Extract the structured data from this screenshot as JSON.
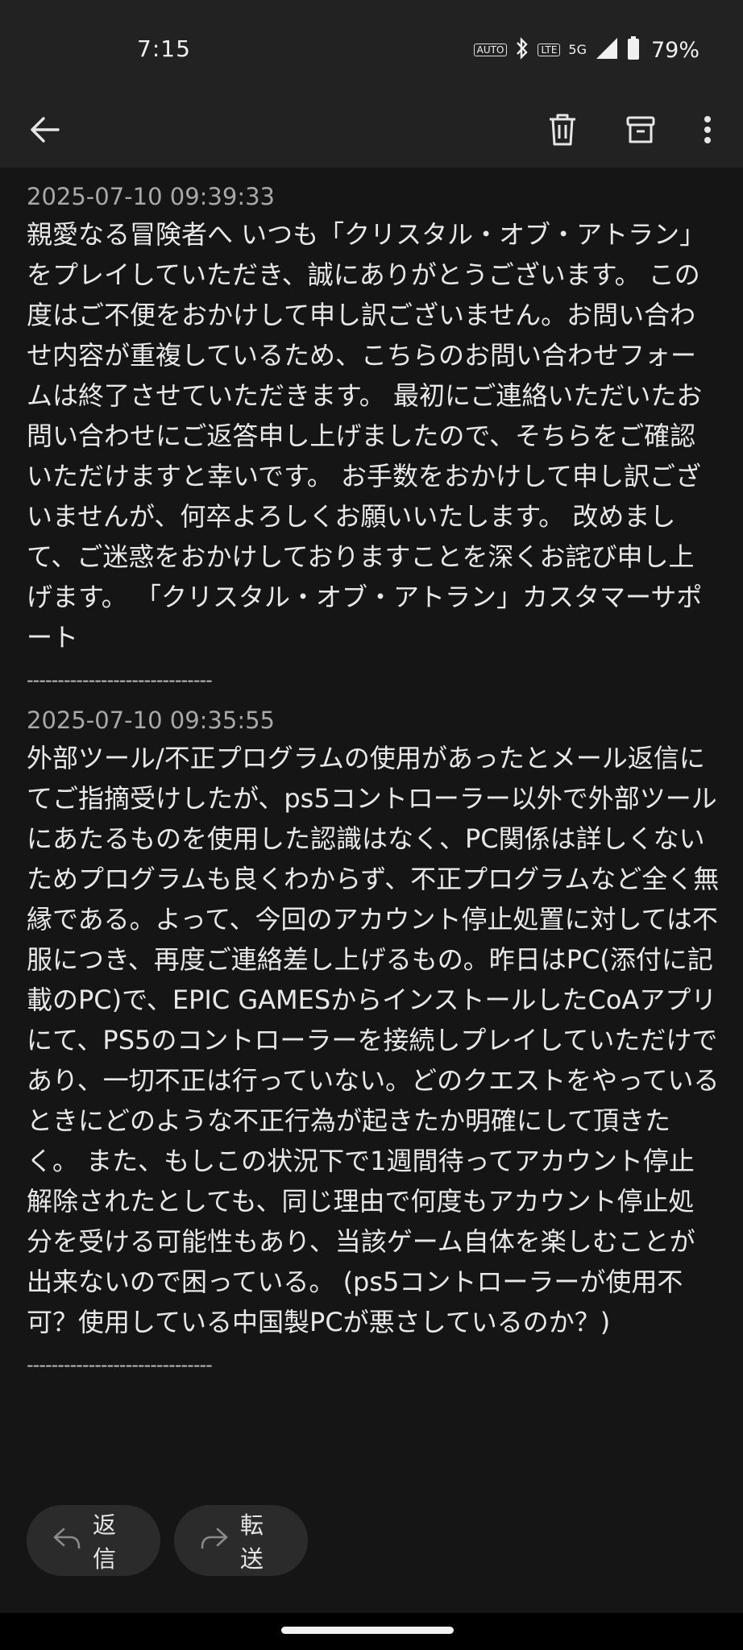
{
  "status_bar": {
    "time": "7:15",
    "auto_label": "AUTO",
    "volte_label": "LTE",
    "network": "5G",
    "battery": "79%"
  },
  "toolbar": {
    "back_icon": "arrow-left-icon",
    "delete_icon": "trash-icon",
    "archive_icon": "archive-icon",
    "more_icon": "more-vert-icon"
  },
  "messages": [
    {
      "date": "2025-07-10 09:39:33",
      "body": "親愛なる冒険者へ いつも「クリスタル・オブ・アトラン」をプレイしていただき、誠にありがとうございます。 この度はご不便をおかけして申し訳ございません。お問い合わせ内容が重複しているため、こちらのお問い合わせフォームは終了させていただきます。 最初にご連絡いただいたお問い合わせにご返答申し上げましたので、そちらをご確認いただけますと幸いです。 お手数をおかけして申し訳ございませんが、何卒よろしくお願いいたします。 改めまして、ご迷惑をおかけしておりますことを深くお詫び申し上げます。 「クリスタル・オブ・アトラン」カスタマーサポート",
      "separator": "------------------------------"
    },
    {
      "date": "2025-07-10 09:35:55",
      "body": "外部ツール/不正プログラムの使用があったとメール返信にてご指摘受けしたが、ps5コントローラー以外で外部ツールにあたるものを使用した認識はなく、PC関係は詳しくないためプログラムも良くわからず、不正プログラムなど全く無縁である。よって、今回のアカウント停止処置に対しては不服につき、再度ご連絡差し上げるもの。昨日はPC(添付に記載のPC)で、EPIC GAMESからインストールしたCoAアプリにて、PS5のコントローラーを接続しプレイしていただけであり、一切不正は行っていない。どのクエストをやっているときにどのような不正行為が起きたか明確にして頂きたく。 また、もしこの状況下で1週間待ってアカウント停止解除されたとしても、同じ理由で何度もアカウント停止処分を受ける可能性もあり、当該ゲーム自体を楽しむことが出来ないので困っている。 (ps5コントローラーが使用不可？使用している中国製PCが悪さしているのか？)",
      "separator": "------------------------------"
    }
  ],
  "actions": {
    "reply_label": "返信",
    "forward_label": "転送",
    "reply_icon": "reply-icon",
    "forward_icon": "forward-icon"
  },
  "colors": {
    "background": "#151515",
    "bar": "#222222",
    "button": "#2b2b2b",
    "text": "#e8e8e8",
    "date": "#a8a8a8"
  }
}
